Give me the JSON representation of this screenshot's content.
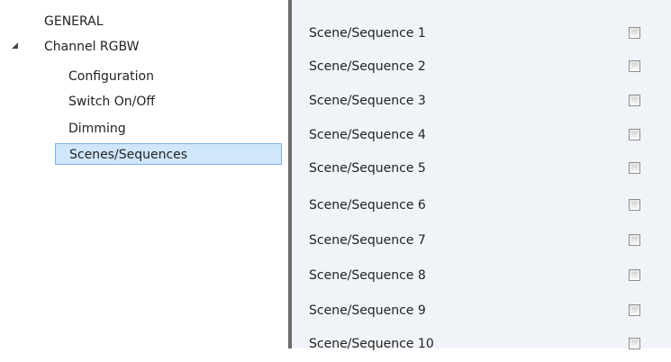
{
  "tree": {
    "items": [
      {
        "label": "GENERAL"
      },
      {
        "label": "Channel RGBW",
        "expanded": true
      },
      {
        "label": "Configuration"
      },
      {
        "label": "Switch On/Off"
      },
      {
        "label": "Dimming"
      },
      {
        "label": "Scenes/Sequences",
        "selected": true
      }
    ],
    "expander_glyph": "◢"
  },
  "content": {
    "rows": [
      {
        "label": "Scene/Sequence 1",
        "checked": false
      },
      {
        "label": "Scene/Sequence 2",
        "checked": false
      },
      {
        "label": "Scene/Sequence 3",
        "checked": false
      },
      {
        "label": "Scene/Sequence 4",
        "checked": false
      },
      {
        "label": "Scene/Sequence 5",
        "checked": false
      },
      {
        "label": "Scene/Sequence 6",
        "checked": false
      },
      {
        "label": "Scene/Sequence 7",
        "checked": false
      },
      {
        "label": "Scene/Sequence 8",
        "checked": false
      },
      {
        "label": "Scene/Sequence 9",
        "checked": false
      },
      {
        "label": "Scene/Sequence 10",
        "checked": false
      }
    ]
  },
  "colors": {
    "selection_bg": "#cfe6fb",
    "selection_border": "#7db3e6",
    "content_bg": "#f0f4f9",
    "splitter": "#6b6b6b"
  }
}
